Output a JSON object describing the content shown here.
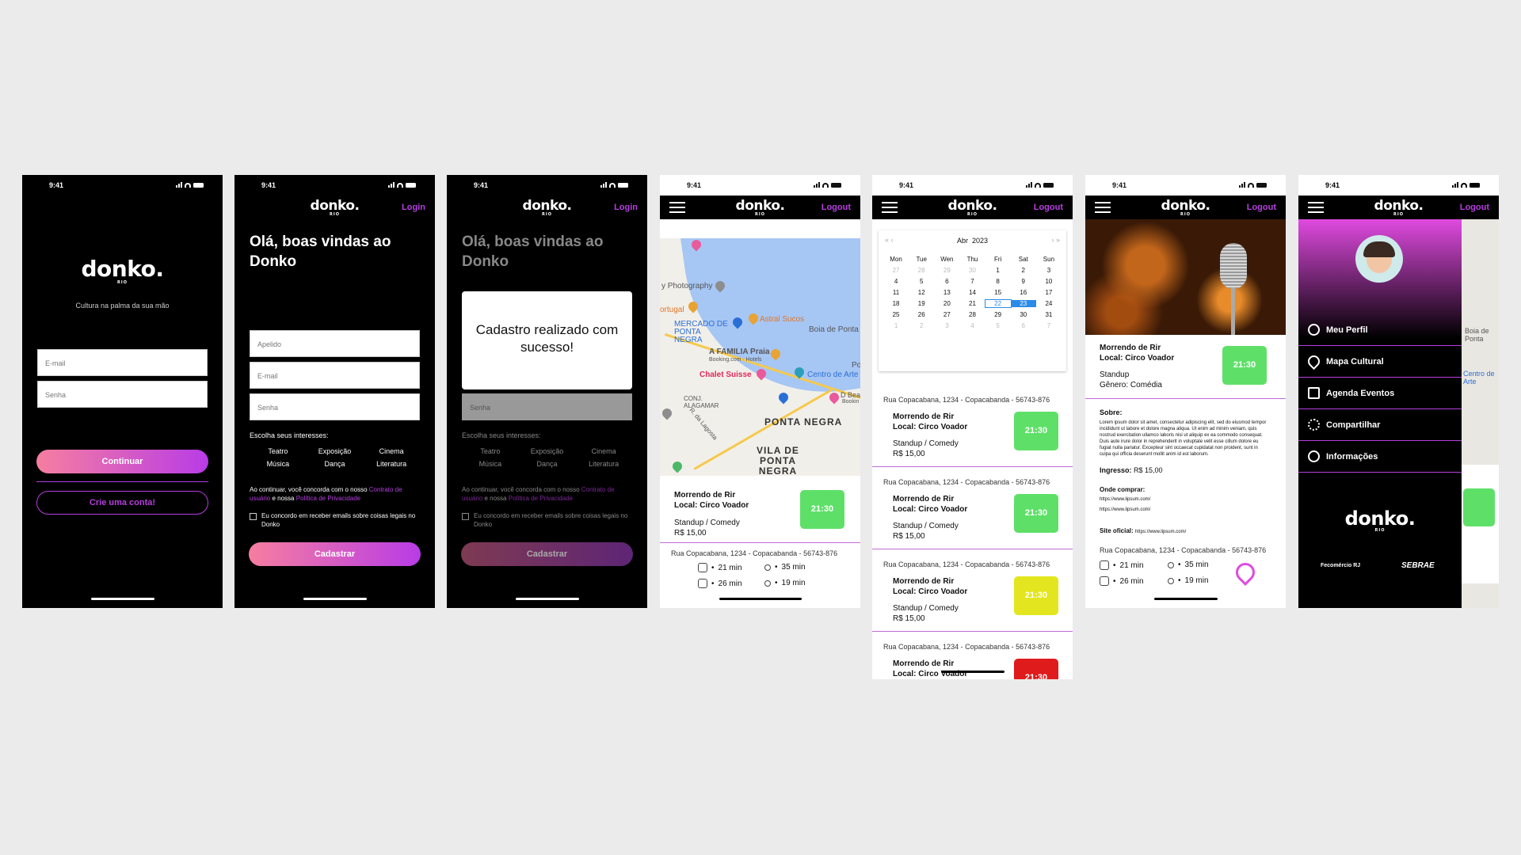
{
  "status": {
    "time": "9:41"
  },
  "brand": {
    "name": "donko.",
    "sub": "RIO"
  },
  "screen1": {
    "tagline": "Cultura na palma da sua mão",
    "email_placeholder": "E-mail",
    "password_placeholder": "Senha",
    "continue_label": "Continuar",
    "create_label": "Crie uma conta!"
  },
  "signup": {
    "login_link": "Login",
    "heading": "Olá, boas vindas ao Donko",
    "nickname_placeholder": "Apelido",
    "email_placeholder": "E-mail",
    "password_placeholder": "Senha",
    "interests_title": "Escolha seus interesses:",
    "interests": [
      "Teatro",
      "Exposição",
      "Cinema",
      "Música",
      "Dança",
      "Literatura"
    ],
    "terms_prefix": "Ao continuar, você concorda com o nosso",
    "terms_link1": "Contrato de usuário",
    "terms_mid": "e nossa",
    "terms_link2": "Política de Privacidade",
    "newsletter": "Eu concordo em receber emails sobre coisas legais no Donko",
    "submit_label": "Cadastrar"
  },
  "success": {
    "message": "Cadastro realizado com sucesso!"
  },
  "topbar": {
    "logout": "Logout"
  },
  "map": {
    "labels": [
      "y Photography",
      "ortugal",
      "MERCADO DE PONTA NEGRA",
      "Astral Sucos",
      "Boia de Ponta",
      "A FAMILIA Praia",
      "Booking.com · Hotels",
      "Chalet Suisse",
      "Centro de Arte",
      "CONJ. ALAGAMAR",
      "PONTA NEGRA",
      "VILA DE PONTA NEGRA",
      "R. da Lagosta",
      "D Bea",
      "Bookin",
      "Po"
    ]
  },
  "event": {
    "title": "Morrendo de Rir",
    "venue": "Local: Circo Voador",
    "genre": "Standup / Comedy",
    "price": "R$ 15,00",
    "time": "21:30",
    "address": "Rua Copacabana, 1234 - Copacabanda - 56743-876",
    "travel": {
      "bus": "21 min",
      "walk": "35 min",
      "car": "26 min",
      "bike": "19 min"
    }
  },
  "calendar": {
    "month": "Abr",
    "year": "2023",
    "weekdays": [
      "Mon",
      "Tue",
      "Wen",
      "Thu",
      "Fri",
      "Sat",
      "Sun"
    ],
    "days": [
      "27",
      "28",
      "29",
      "30",
      "1",
      "2",
      "3",
      "4",
      "5",
      "6",
      "7",
      "8",
      "9",
      "10",
      "11",
      "12",
      "13",
      "14",
      "15",
      "16",
      "17",
      "18",
      "19",
      "20",
      "21",
      "22",
      "23",
      "24",
      "25",
      "26",
      "27",
      "28",
      "29",
      "30",
      "31",
      "1",
      "2",
      "3",
      "4",
      "5",
      "6",
      "7"
    ],
    "today": "22",
    "selected": "23",
    "time_colors": [
      "#5ee068",
      "#5ee068",
      "#e3e61e",
      "#e01b1b"
    ]
  },
  "detail": {
    "standup": "Standup",
    "genre": "Gênero: Comédia",
    "about_title": "Sobre:",
    "about_text": "Lorem ipsum dolor sit amet, consectetur adipiscing elit, sed do eiusmod tempor incididunt ut labore et dolore magna aliqua. Ut enim ad minim veniam, quis nostrud exercitation ullamco laboris nisi ut aliquip ex ea commodo consequat. Duis aute irure dolor in reprehenderit in voluptate velit esse cillum dolore eu fugiat nulla pariatur. Excepteur sint occaecat cupidatat non proident, sunt in culpa qui officia deserunt mollit anim id est laborum.",
    "ticket_label": "Ingresso:",
    "ticket_price": "R$ 15,00",
    "buy_title": "Onde comprar:",
    "buy_link1": "https://www.lipsum.com/",
    "buy_link2": "https://www.lipsum.com/",
    "site_label": "Site oficial:",
    "site_link": "https://www.lipsum.com/"
  },
  "menu": {
    "items": [
      "Meu Perfil",
      "Mapa Cultural",
      "Agenda Eventos",
      "Compartilhar",
      "Informações"
    ],
    "sponsor1": "Fecomércio RJ",
    "sponsor2": "SEBRAE"
  },
  "colors": {
    "accent": "#b73ee0",
    "green": "#5ee068",
    "yellow": "#e3e61e",
    "red": "#e01b1b"
  }
}
